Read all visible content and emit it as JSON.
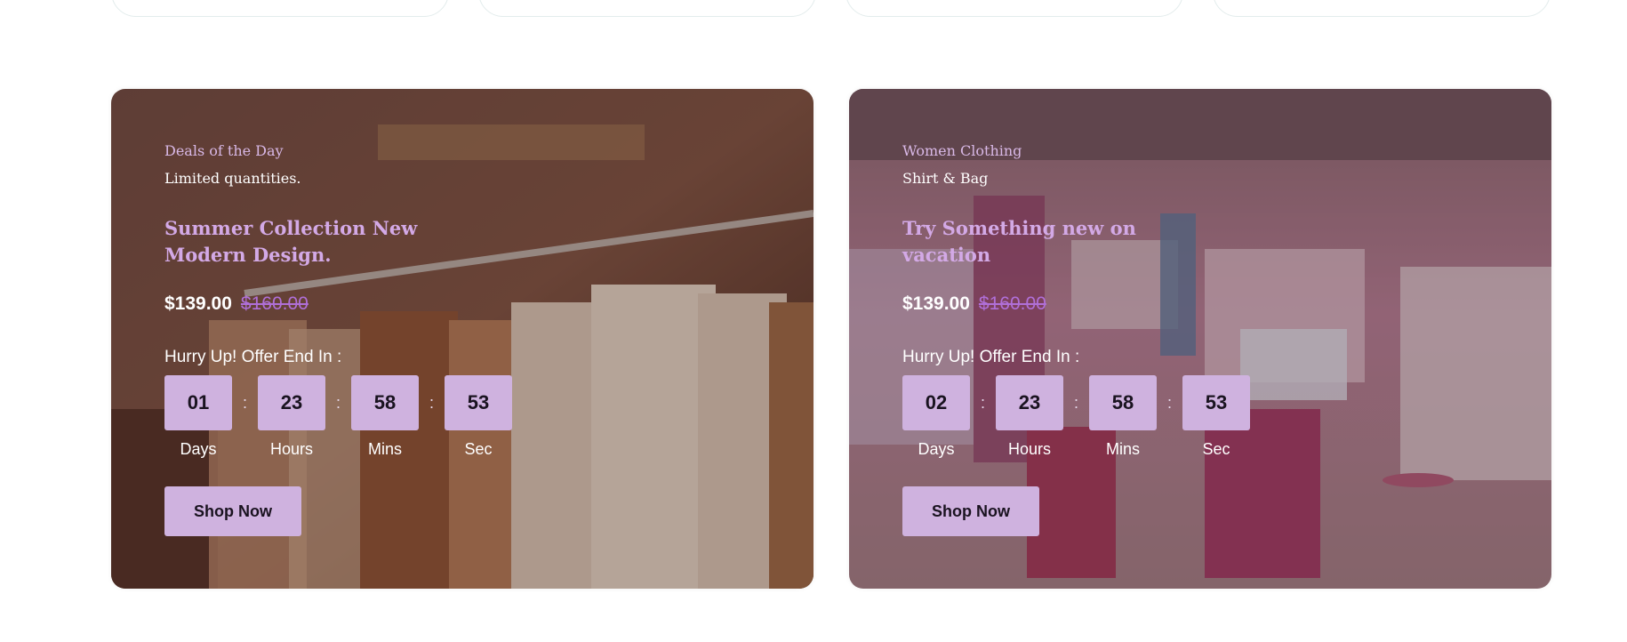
{
  "deals": [
    {
      "eyebrow": "Deals of the Day",
      "subhead": "Limited quantities.",
      "headline": "Summer Collection New Modern Design.",
      "price": "$139.00",
      "old_price": "$160.00",
      "hurry": "Hurry Up! Offer End In :",
      "timer": {
        "days": "01",
        "hours": "23",
        "mins": "58",
        "sec": "53",
        "days_label": "Days",
        "hours_label": "Hours",
        "mins_label": "Mins",
        "sec_label": "Sec",
        "separator": ":"
      },
      "button": "Shop Now"
    },
    {
      "eyebrow": "Women Clothing",
      "subhead": "Shirt & Bag",
      "headline": "Try Something new on vacation",
      "price": "$139.00",
      "old_price": "$160.00",
      "hurry": "Hurry Up! Offer End In :",
      "timer": {
        "days": "02",
        "hours": "23",
        "mins": "58",
        "sec": "53",
        "days_label": "Days",
        "hours_label": "Hours",
        "mins_label": "Mins",
        "sec_label": "Sec",
        "separator": ":"
      },
      "button": "Shop Now"
    }
  ],
  "colors": {
    "accent": "#cfb2df",
    "eyebrow": "#d8b8e6",
    "headline": "#d3a9e6",
    "old_price": "#b06fd8"
  }
}
